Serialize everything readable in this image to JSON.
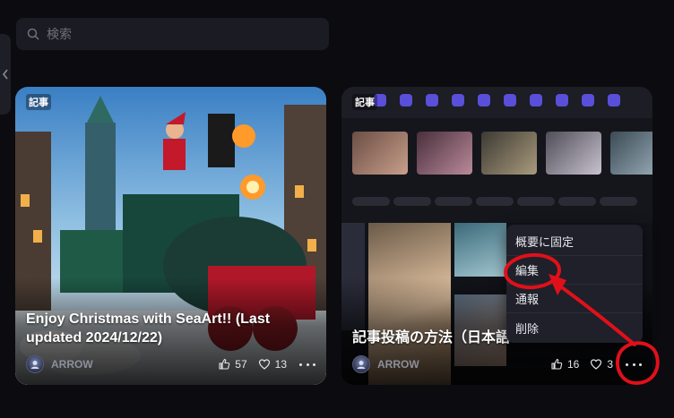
{
  "search": {
    "placeholder": "検索"
  },
  "cards": [
    {
      "tag": "記事",
      "title": "Enjoy Christmas with SeaArt!! (Last updated 2024/12/22)",
      "author": "ARROW",
      "likes": "57",
      "favorites": "13"
    },
    {
      "tag": "記事",
      "title": "記事投稿の方法（日本語",
      "author": "ARROW",
      "likes": "16",
      "favorites": "3"
    }
  ],
  "context_menu": {
    "items": [
      "概要に固定",
      "編集",
      "通報",
      "削除"
    ]
  },
  "colors": {
    "background": "#0b0b10",
    "surface": "#1b1c23",
    "annotation": "#e0101a"
  },
  "icons": [
    "search-icon",
    "chevron-left-icon",
    "thumbs-up-icon",
    "heart-icon",
    "more-icon",
    "avatar-icon"
  ]
}
